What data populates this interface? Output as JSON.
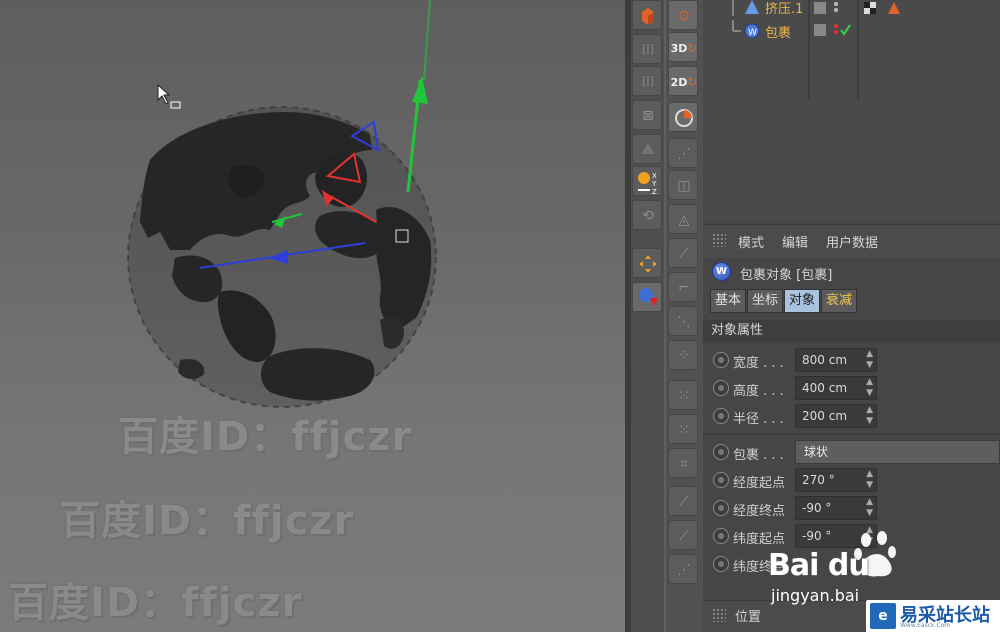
{
  "viewport": {
    "watermarks": [
      "百度ID：ffjczr",
      "百度ID：ffjczr",
      "百度ID：ffjczr"
    ]
  },
  "toolbar": {
    "tool_3d_label": "3D",
    "tool_2d_label": "2D",
    "tool_xyz_label": "X\nY\nZ"
  },
  "object_manager": {
    "objects": [
      {
        "name": "挤压.1"
      },
      {
        "name": "包裹"
      }
    ]
  },
  "attributes": {
    "menu": [
      "模式",
      "编辑",
      "用户数据"
    ],
    "object_title": "包裹对象 [包裹]",
    "tabs": [
      "基本",
      "坐标",
      "对象",
      "衰减"
    ],
    "section": "对象属性",
    "props": [
      {
        "label": "宽度 . . .",
        "value": "800 cm"
      },
      {
        "label": "高度 . . .",
        "value": "400 cm"
      },
      {
        "label": "半径 . . .",
        "value": "200 cm"
      }
    ],
    "wrap": {
      "label": "包裹 . . .",
      "value": "球状"
    },
    "angles": [
      {
        "label": "经度起点",
        "value": "270 °"
      },
      {
        "label": "经度终点",
        "value": "-90 °"
      },
      {
        "label": "纬度起点",
        "value": "-90 °"
      },
      {
        "label": "纬度终点",
        "value": ""
      }
    ],
    "bottom_section": "位置"
  },
  "overlay": {
    "baidu": "Bai du",
    "jingyan": "jingyan.bai",
    "yicai": "易采站长站",
    "yicai_sub": "Www.Easck.Com"
  },
  "colors": {
    "accent_object": "#e9b44c",
    "tab_active": "#a9c3df",
    "axis_y": "#22c43a",
    "axis_x": "#e23232",
    "axis_z": "#2d3fd8"
  }
}
